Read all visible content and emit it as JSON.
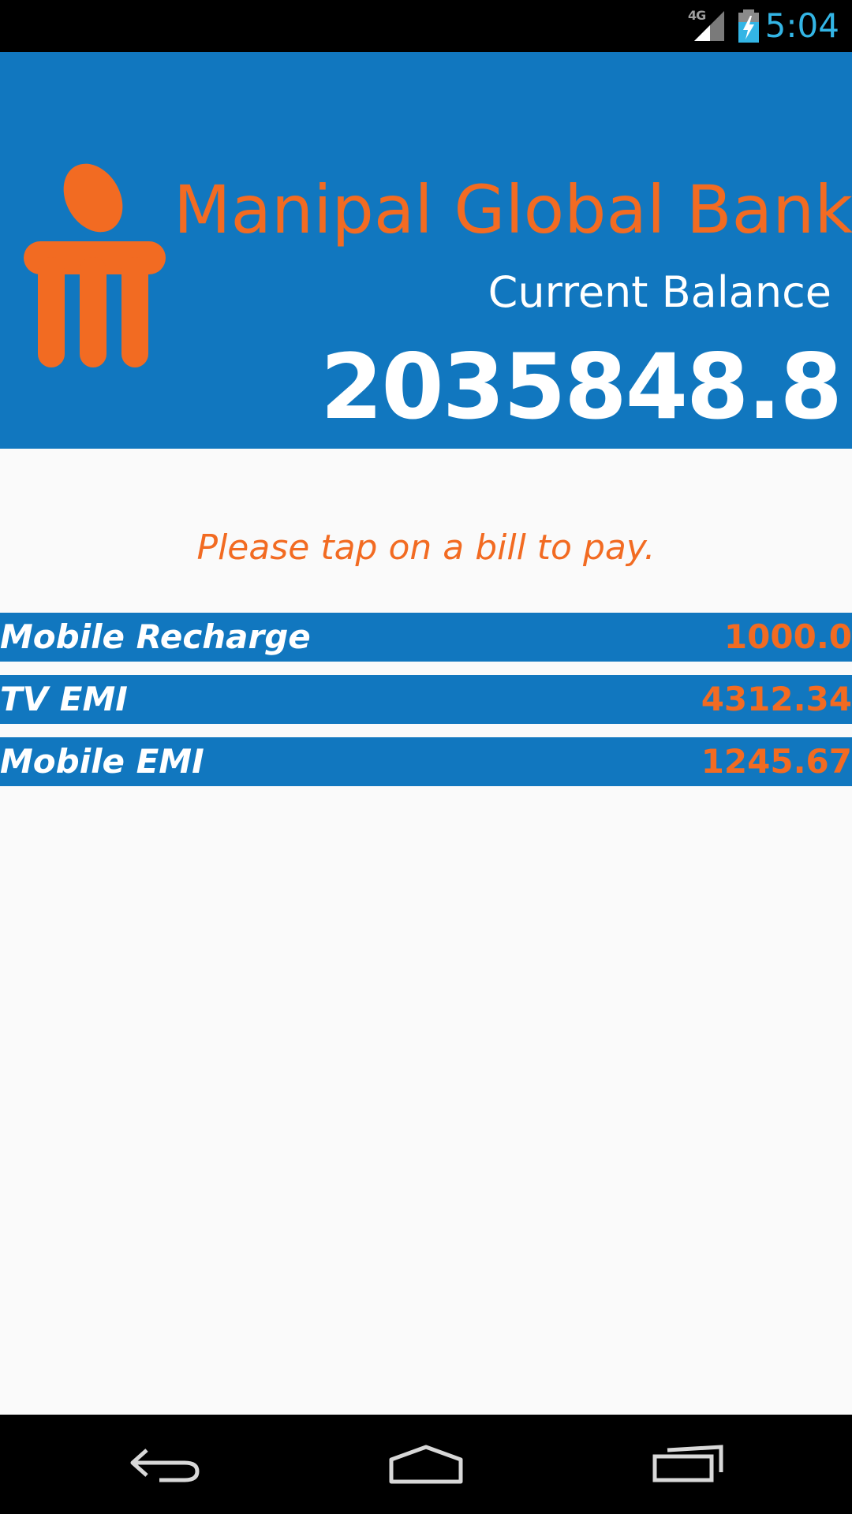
{
  "status_bar": {
    "network": "4G",
    "time": "5:04"
  },
  "header": {
    "bank_name": "Manipal Global Bank",
    "balance_label": "Current Balance",
    "balance_value": "2035848.8"
  },
  "instruction": "Please tap on a bill to pay.",
  "bills": [
    {
      "name": "Mobile Recharge",
      "amount": "1000.0"
    },
    {
      "name": "TV EMI",
      "amount": "4312.34"
    },
    {
      "name": "Mobile EMI",
      "amount": "1245.67"
    }
  ],
  "nav_bar": {
    "icons": [
      "back-icon",
      "home-icon",
      "recents-icon"
    ]
  },
  "colors": {
    "header_blue": "#1177bf",
    "brand_orange": "#f26b22",
    "status_time_blue": "#33b5e5",
    "background": "#fafafa"
  }
}
